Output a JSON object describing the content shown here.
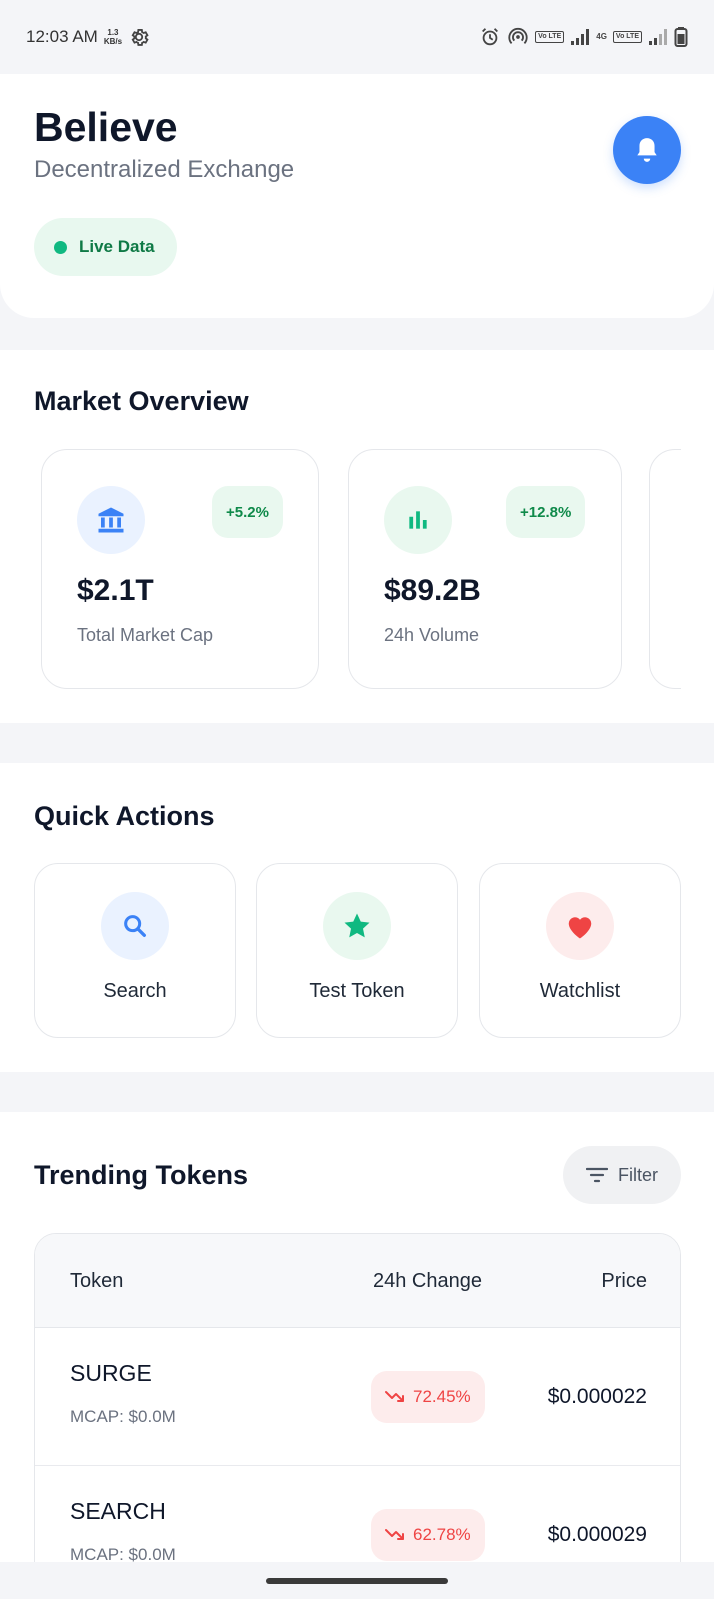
{
  "status_bar": {
    "time": "12:03 AM",
    "net_speed_value": "1.3",
    "net_speed_unit": "KB/s",
    "volte_label": "Vo LTE",
    "network_4g": "4G"
  },
  "header": {
    "title": "Believe",
    "subtitle": "Decentralized Exchange",
    "live_label": "Live Data"
  },
  "market_overview": {
    "title": "Market Overview",
    "cards": [
      {
        "value": "$2.1T",
        "label": "Total Market Cap",
        "change": "+5.2%",
        "icon": "bank-icon",
        "icon_color": "#3b82f6",
        "icon_bg": "#eaf2ff"
      },
      {
        "value": "$89.2B",
        "label": "24h Volume",
        "change": "+12.8%",
        "icon": "bar-chart-icon",
        "icon_color": "#10b981",
        "icon_bg": "#e9f8ef"
      }
    ]
  },
  "quick_actions": {
    "title": "Quick Actions",
    "items": [
      {
        "label": "Search",
        "icon": "search-icon",
        "icon_color": "#3b82f6",
        "icon_bg": "#eaf2ff"
      },
      {
        "label": "Test Token",
        "icon": "star-icon",
        "icon_color": "#10b981",
        "icon_bg": "#e9f8ef"
      },
      {
        "label": "Watchlist",
        "icon": "heart-icon",
        "icon_color": "#ef4444",
        "icon_bg": "#fdecec"
      }
    ]
  },
  "trending": {
    "title": "Trending Tokens",
    "filter_label": "Filter",
    "columns": {
      "token": "Token",
      "change": "24h Change",
      "price": "Price"
    },
    "rows": [
      {
        "name": "SURGE",
        "mcap": "MCAP: $0.0M",
        "change": "72.45%",
        "price": "$0.000022"
      },
      {
        "name": "SEARCH",
        "mcap": "MCAP: $0.0M",
        "change": "62.78%",
        "price": "$0.000029"
      }
    ]
  },
  "colors": {
    "accent_blue": "#3b82f6",
    "positive_green": "#10b981",
    "negative_red": "#ef4444"
  }
}
